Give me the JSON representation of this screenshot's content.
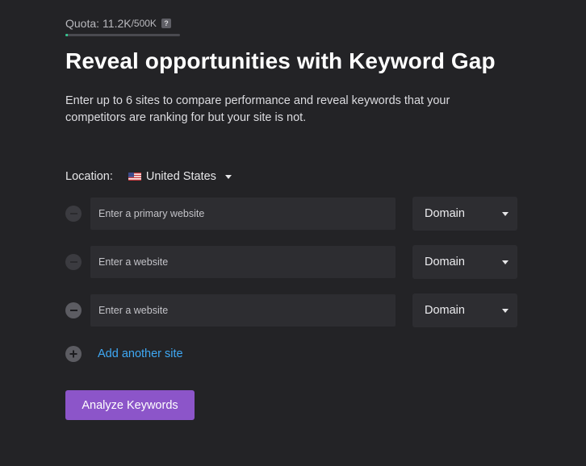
{
  "quota": {
    "label": "Quota:",
    "used": "11.2K",
    "total": "/500K",
    "help": "?",
    "fraction_used": 0.0224
  },
  "title": "Reveal opportunities with Keyword Gap",
  "description": "Enter up to 6 sites to compare performance and reveal keywords that your competitors are ranking for but your site is not.",
  "location": {
    "label": "Location:",
    "flag_icon": "us-flag-icon",
    "value": "United States"
  },
  "sites": [
    {
      "placeholder": "Enter a primary website",
      "value": "",
      "type": "Domain",
      "remove_enabled": false
    },
    {
      "placeholder": "Enter a website",
      "value": "",
      "type": "Domain",
      "remove_enabled": false
    },
    {
      "placeholder": "Enter a website",
      "value": "",
      "type": "Domain",
      "remove_enabled": true
    }
  ],
  "add_site_label": "Add another site",
  "analyze_label": "Analyze Keywords",
  "colors": {
    "background": "#232326",
    "accent_button": "#8c55c9",
    "link": "#3fa9f5",
    "quota_fill": "#36c38f"
  }
}
